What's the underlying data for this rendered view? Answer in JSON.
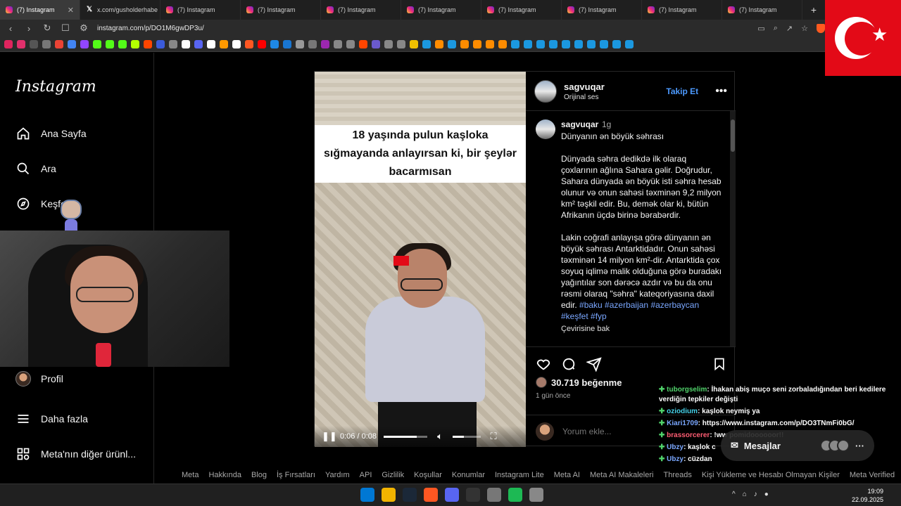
{
  "browser": {
    "tabs": [
      {
        "title": "(7) Instagram",
        "icon": "instagram-icon",
        "active": true
      },
      {
        "title": "x.com/gusholderhabe",
        "icon": "x-icon",
        "active": false
      },
      {
        "title": "(7) Instagram",
        "icon": "instagram-icon",
        "active": false
      },
      {
        "title": "(7) Instagram",
        "icon": "instagram-icon",
        "active": false
      },
      {
        "title": "(7) Instagram",
        "icon": "instagram-icon",
        "active": false
      },
      {
        "title": "(7) Instagram",
        "icon": "instagram-icon",
        "active": false
      },
      {
        "title": "(7) Instagram",
        "icon": "instagram-icon",
        "active": false
      },
      {
        "title": "(7) Instagram",
        "icon": "instagram-icon",
        "active": false
      },
      {
        "title": "(7) Instagram",
        "icon": "instagram-icon",
        "active": false
      },
      {
        "title": "(7) Instagram",
        "icon": "instagram-icon",
        "active": false
      }
    ],
    "new_tab_glyph": "+",
    "url": "instagram.com/p/DO1M6gwDP3u/",
    "bookmark_colors": [
      "#e0245e",
      "#e1306c",
      "#555555",
      "#777777",
      "#ea4335",
      "#4285f4",
      "#9146ff",
      "#53fc18",
      "#53fc18",
      "#53fc18",
      "#b3ff00",
      "#ff4500",
      "#3b5bdb",
      "#888888",
      "#ffffff",
      "#5865f2",
      "#ffffff",
      "#ff9900",
      "#ffffff",
      "#ff5722",
      "#ff0000",
      "#1e88e5",
      "#1976d2",
      "#999999",
      "#777777",
      "#9c27b0",
      "#888888",
      "#888888",
      "#ff4500",
      "#6a5acd",
      "#888888",
      "#888888",
      "#f0c000",
      "#1b98e0",
      "#ff8c00",
      "#1b98e0",
      "#ff8c00",
      "#ff8c00",
      "#ff8c00",
      "#ff8c00",
      "#1b98e0",
      "#1b98e0",
      "#1b98e0",
      "#1b98e0",
      "#1b98e0",
      "#1b98e0",
      "#1b98e0",
      "#1b98e0",
      "#1b98e0",
      "#1b98e0"
    ]
  },
  "sidebar": {
    "logo": "Instagram",
    "items": [
      {
        "label": "Ana Sayfa",
        "icon": "home-icon"
      },
      {
        "label": "Ara",
        "icon": "search-icon"
      },
      {
        "label": "Keşfet",
        "icon": "compass-icon"
      },
      {
        "label": "Profil",
        "icon": "avatar"
      },
      {
        "label": "Daha fazla",
        "icon": "menu-icon"
      },
      {
        "label": "Meta'nın diğer ürünl...",
        "icon": "grid-icon"
      }
    ]
  },
  "video": {
    "overlay_text": "18 yaşında pulun kaşloka sığmayanda anlayırsan ki, bir şeylər bacarmısan",
    "time": "0:06 / 0:08",
    "progress": 0.75,
    "volume": 0.4
  },
  "post": {
    "username": "sagvuqar",
    "audio": "Orijinal ses",
    "follow_label": "Takip Et",
    "caption_user": "sagvuqar",
    "caption_age": "1g",
    "caption_title": "Dünyanın ən böyük səhrası",
    "caption_p1": "Dünyada səhra dedikdə ilk olaraq çoxlarının ağlına Sahara gəlir. Doğrudur, Sahara dünyada ən böyük isti səhra hesab olunur və onun sahəsi təxminən 9,2 milyon km² təşkil edir. Bu, demək olar ki, bütün Afrikanın üçdə birinə bərabərdir.",
    "caption_p2": "Lakin coğrafi anlayışa görə dünyanın ən böyük səhrası Antarktidadır. Onun sahəsi təxminən 14 milyon km²-dir. Antarktida çox soyuq iqlimə malik olduğuna görə buradakı yağıntılar son dərəcə azdır və bu da onu rəsmi olaraq \"səhra\" kateqoriyasına daxil edir.",
    "hashtags": "#baku #azerbaijan #azerbaycan #keşfet #fyp",
    "translate": "Çevirisine bak",
    "likes": "30.719 beğenme",
    "date": "1 gün önce",
    "comment_placeholder": "Yorum ekle..."
  },
  "footer": {
    "links": [
      "Meta",
      "Hakkında",
      "Blog",
      "İş Fırsatları",
      "Yardım",
      "API",
      "Gizlilik",
      "Koşullar",
      "Konumlar",
      "Instagram Lite",
      "Meta AI",
      "Meta AI Makaleleri",
      "Threads",
      "Kişi Yükleme ve Hesabı Olmayan Kişiler",
      "Meta Verified"
    ]
  },
  "chat": {
    "messages": [
      {
        "user": "tuborgselim",
        "color": "green",
        "text": ": İhakan abiş muço seni zorbaladığından beri kedilere verdiğin tepkiler değişti"
      },
      {
        "user": "oziodium",
        "color": "cyan",
        "text": ": kaşlok neymiş ya"
      },
      {
        "user": "Kiari1709",
        "color": "blue",
        "text": ": https://www.instagram.com/p/DO3TNmFi0bG/"
      },
      {
        "user": "brassorcerer",
        "color": "red",
        "text": ": !ww pomidoooooor!!"
      },
      {
        "user": "Ubzy",
        "color": "blue",
        "text": ": kaşlok c"
      },
      {
        "user": "Ubzy",
        "color": "blue",
        "text": ": cüzdan"
      }
    ]
  },
  "messages_pill": {
    "label": "Mesajlar"
  },
  "taskbar": {
    "app_colors": [
      "#0078d4",
      "#f2b400",
      "#1b2838",
      "#ff5722",
      "#5865f2",
      "#333333",
      "#777777",
      "#1db954",
      "#888888"
    ],
    "time": "19:09",
    "date": "22.09.2025"
  }
}
